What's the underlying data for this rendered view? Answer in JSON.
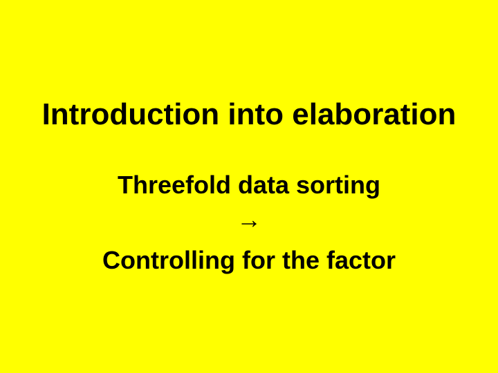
{
  "slide": {
    "title": "Introduction into elaboration",
    "subtitle": "Threefold data sorting",
    "arrow": "→",
    "conclusion": "Controlling for the factor"
  }
}
